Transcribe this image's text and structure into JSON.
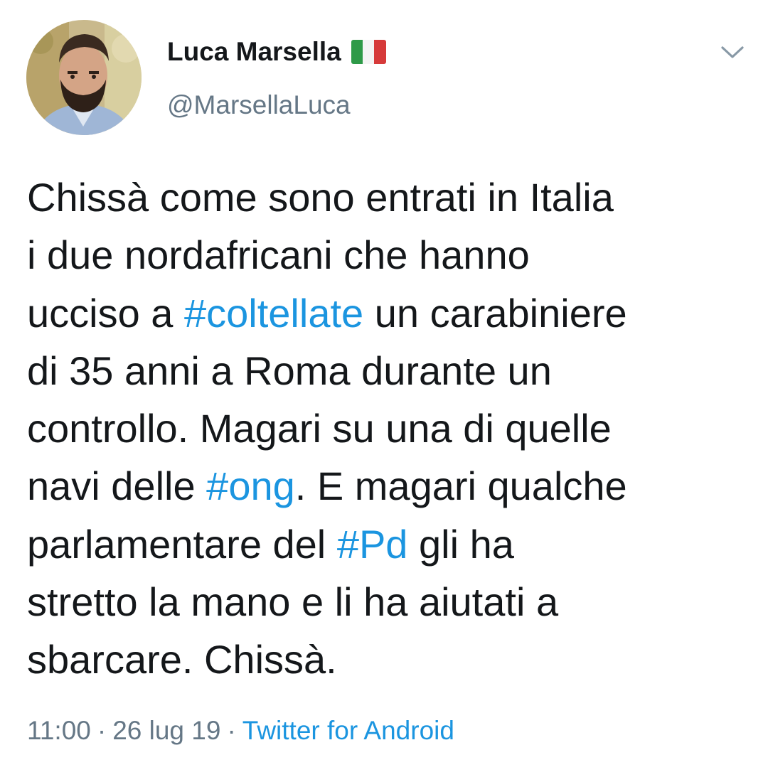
{
  "author": {
    "name": "Luca Marsella",
    "handle": "@MarsellaLuca",
    "flag_icon": "italy-flag-icon",
    "flag_colors": [
      "#2e9a48",
      "#f4f4f4",
      "#d63a3a"
    ]
  },
  "menu": {
    "icon": "chevron-down-icon"
  },
  "tweet": {
    "lines": [
      [
        {
          "t": "Chissà come sono entrati in Italia"
        }
      ],
      [
        {
          "t": "i due nordafricani che hanno"
        }
      ],
      [
        {
          "t": "ucciso a "
        },
        {
          "t": "#coltellate",
          "tag": true
        },
        {
          "t": " un carabiniere"
        }
      ],
      [
        {
          "t": "di 35 anni a Roma durante un"
        }
      ],
      [
        {
          "t": "controllo. Magari su una di quelle"
        }
      ],
      [
        {
          "t": "navi delle "
        },
        {
          "t": "#ong",
          "tag": true
        },
        {
          "t": ". E magari qualche"
        }
      ],
      [
        {
          "t": "parlamentare del "
        },
        {
          "t": "#Pd",
          "tag": true
        },
        {
          "t": " gli ha"
        }
      ],
      [
        {
          "t": "stretto la mano e li ha aiutati a"
        }
      ],
      [
        {
          "t": "sbarcare. Chissà."
        }
      ]
    ]
  },
  "meta": {
    "time": "11:00",
    "separator": "·",
    "date": "26 lug 19",
    "source": "Twitter for Android"
  },
  "colors": {
    "text": "#14171a",
    "secondary": "#657786",
    "link": "#1b95e0"
  }
}
